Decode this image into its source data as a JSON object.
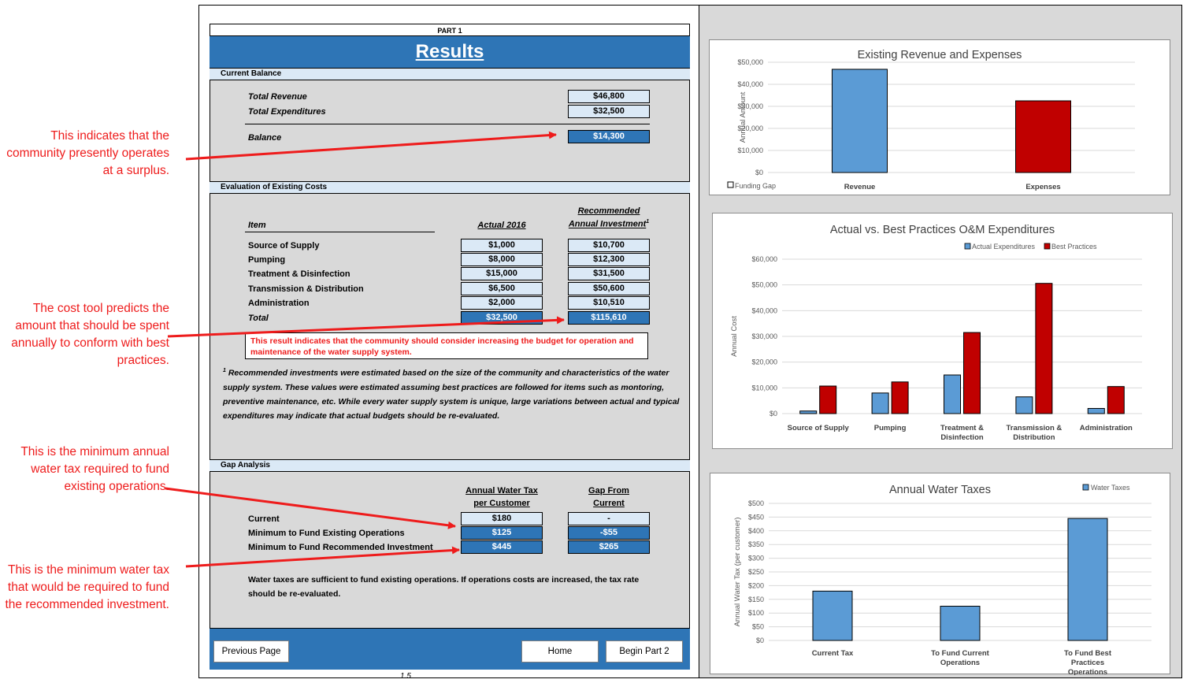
{
  "annotations": [
    "This indicates that the community presently operates at a surplus.",
    "The cost tool predicts the amount that should be spent annually to conform with best practices.",
    "This is the minimum annual water tax required to fund existing operations.",
    "This is the minimum water tax that would be required to fund the recommended investment."
  ],
  "header": {
    "part": "PART 1",
    "title": "Results"
  },
  "current_balance": {
    "section": "Current Balance",
    "total_revenue_label": "Total Revenue",
    "total_revenue": "$46,800",
    "total_expenditures_label": "Total Expenditures",
    "total_expenditures": "$32,500",
    "balance_label": "Balance",
    "balance": "$14,300"
  },
  "evaluation": {
    "section": "Evaluation of Existing Costs",
    "col_item": "Item",
    "col_actual": "Actual 2016",
    "col_rec_line1": "Recommended",
    "col_rec_line2": "Annual Investment",
    "col_rec_sup": "1",
    "rows": [
      {
        "item": "Source of Supply",
        "actual": "$1,000",
        "rec": "$10,700"
      },
      {
        "item": "Pumping",
        "actual": "$8,000",
        "rec": "$12,300"
      },
      {
        "item": "Treatment & Disinfection",
        "actual": "$15,000",
        "rec": "$31,500"
      },
      {
        "item": "Transmission & Distribution",
        "actual": "$6,500",
        "rec": "$50,600"
      },
      {
        "item": "Administration",
        "actual": "$2,000",
        "rec": "$10,510"
      }
    ],
    "total_label": "Total",
    "total_actual": "$32,500",
    "total_rec": "$115,610",
    "message": "This result indicates that the community should consider increasing the budget for operation and maintenance of the water supply system.",
    "footnote_sup": "1",
    "footnote": "Recommended investments were estimated based on the size of the community and characteristics of the water supply system. These values were estimated assuming best practices are followed for items such as montoring, preventive maintenance, etc. While every water supply system is unique, large variations between actual and typical expenditures  may indicate that actual budgets should be re-evaluated."
  },
  "gap": {
    "section": "Gap Analysis",
    "col_tax_line1": "Annual Water Tax",
    "col_tax_line2": "per Customer",
    "col_gap_line1": "Gap From",
    "col_gap_line2": "Current",
    "rows": [
      {
        "label": "Current",
        "tax": "$180",
        "gap": "-"
      },
      {
        "label": "Minimum to Fund Existing Operations",
        "tax": "$125",
        "gap": "-$55"
      },
      {
        "label": "Minimum to Fund Recommended Investment",
        "tax": "$445",
        "gap": "$265"
      }
    ],
    "message": "Water taxes are sufficient to fund existing operations. If operations costs are increased, the tax rate should be re-evaluated."
  },
  "buttons": {
    "previous": "Previous Page",
    "home": "Home",
    "begin_part2": "Begin Part 2"
  },
  "page_number": "1.5",
  "colors": {
    "blue": "#2e75b6",
    "light_blue": "#dbe9f6",
    "bar_blue": "#5b9bd5",
    "bar_red": "#c00000",
    "annotation_red": "#ee1c1c"
  },
  "chart_data": [
    {
      "type": "bar",
      "title": "Existing Revenue and Expenses",
      "ylabel": "Annual Amount",
      "categories": [
        "Revenue",
        "Expenses"
      ],
      "values": [
        46800,
        32500
      ],
      "colors": [
        "#5b9bd5",
        "#c00000"
      ],
      "ylim": [
        0,
        50000
      ],
      "yticks": [
        "$0",
        "$10,000",
        "$20,000",
        "$30,000",
        "$40,000",
        "$50,000"
      ],
      "legend": [
        "Funding Gap"
      ],
      "legend_position": "bottom-left"
    },
    {
      "type": "bar",
      "title": "Actual vs. Best Practices O&M Expenditures",
      "ylabel": "Annual Cost",
      "categories": [
        "Source of Supply",
        "Pumping",
        "Treatment & Disinfection",
        "Transmission & Distribution",
        "Administration"
      ],
      "series": [
        {
          "name": "Actual Expenditures",
          "values": [
            1000,
            8000,
            15000,
            6500,
            2000
          ],
          "color": "#5b9bd5"
        },
        {
          "name": "Best Practices",
          "values": [
            10700,
            12300,
            31500,
            50600,
            10510
          ],
          "color": "#c00000"
        }
      ],
      "ylim": [
        0,
        60000
      ],
      "yticks": [
        "$0",
        "$10,000",
        "$20,000",
        "$30,000",
        "$40,000",
        "$50,000",
        "$60,000"
      ],
      "legend_position": "top-right"
    },
    {
      "type": "bar",
      "title": "Annual Water Taxes",
      "ylabel": "Annual Water Tax (per customer)",
      "categories": [
        "Current Tax",
        "To Fund Current Operations",
        "To Fund Best Practices Operations"
      ],
      "series": [
        {
          "name": "Water Taxes",
          "values": [
            180,
            125,
            445
          ],
          "color": "#5b9bd5"
        }
      ],
      "ylim": [
        0,
        500
      ],
      "yticks": [
        "$0",
        "$50",
        "$100",
        "$150",
        "$200",
        "$250",
        "$300",
        "$350",
        "$400",
        "$450",
        "$500"
      ],
      "legend_position": "top-right"
    }
  ]
}
